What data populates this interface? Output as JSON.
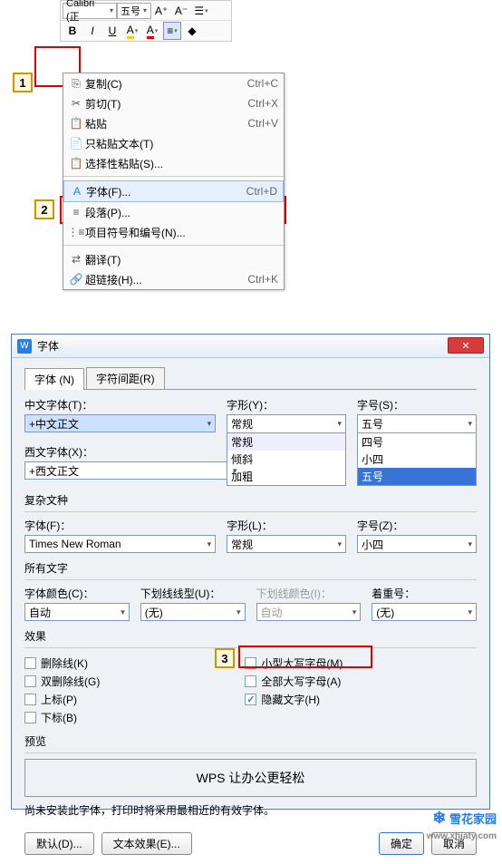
{
  "toolbar": {
    "font_combo": "Calibri (正",
    "size_combo": "五号",
    "increase": "A⁺",
    "decrease": "A⁻",
    "bold": "B",
    "italic": "I",
    "underline": "U"
  },
  "markers": {
    "m1": "1",
    "m2": "2",
    "m3": "3"
  },
  "context": {
    "copy": {
      "label": "复制(C)",
      "short": "Ctrl+C"
    },
    "cut": {
      "label": "剪切(T)",
      "short": "Ctrl+X"
    },
    "paste": {
      "label": "粘贴",
      "short": "Ctrl+V"
    },
    "paste_text": {
      "label": "只粘贴文本(T)"
    },
    "paste_special": {
      "label": "选择性粘贴(S)..."
    },
    "font": {
      "label": "字体(F)...",
      "short": "Ctrl+D"
    },
    "paragraph": {
      "label": "段落(P)..."
    },
    "bullets": {
      "label": "项目符号和编号(N)..."
    },
    "translate": {
      "label": "翻译(T)"
    },
    "hyperlink": {
      "label": "超链接(H)...",
      "short": "Ctrl+K"
    }
  },
  "dialog": {
    "title": "字体",
    "tabs": {
      "font": "字体 (N)",
      "spacing": "字符间距(R)"
    },
    "labels": {
      "cn_font": "中文字体(T)：",
      "en_font": "西文字体(X)：",
      "style": "字形(Y)：",
      "size": "字号(S)：",
      "complex": "复杂文种",
      "c_font": "字体(F)：",
      "c_style": "字形(L)：",
      "c_size": "字号(Z)：",
      "all_text": "所有文字",
      "color": "字体颜色(C)：",
      "underline_style": "下划线线型(U)：",
      "underline_color": "下划线颜色(I)：",
      "emphasis": "着重号：",
      "effects": "效果",
      "strike": "删除线(K)",
      "dstrike": "双删除线(G)",
      "super": "上标(P)",
      "sub": "下标(B)",
      "smallcaps": "小型大写字母(M)",
      "allcaps": "全部大写字母(A)",
      "hidden": "隐藏文字(H)",
      "preview": "预览",
      "note": "尚未安装此字体，打印时将采用最相近的有效字体。"
    },
    "values": {
      "cn_font": "+中文正文",
      "en_font": "+西文正文",
      "style": "常规",
      "c_font": "Times New Roman",
      "c_style": "常规",
      "c_size": "小四",
      "color": "自动",
      "underline_style": "(无)",
      "underline_color": "自动",
      "emphasis": "(无)",
      "preview_text": "WPS 让办公更轻松"
    },
    "style_options": [
      "常规",
      "倾斜",
      "加粗"
    ],
    "size_options": {
      "sel": "五号",
      "o0": "四号",
      "o1": "小四",
      "o2": "五号"
    },
    "buttons": {
      "default": "默认(D)...",
      "text_fx": "文本效果(E)...",
      "ok": "确定",
      "cancel": "取消"
    }
  },
  "watermark": {
    "brand": "雪花家园",
    "url": "www.xhjaty.com"
  }
}
